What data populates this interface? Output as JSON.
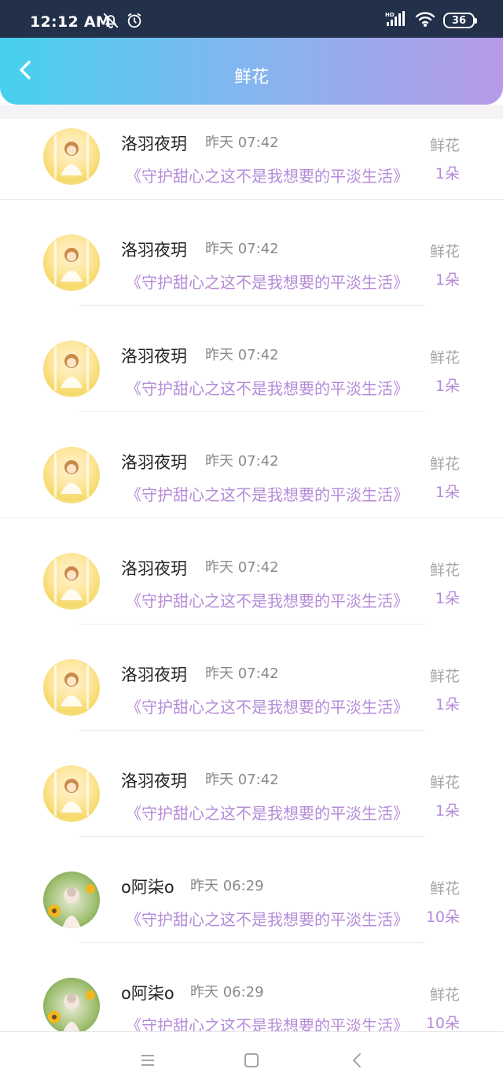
{
  "status_bar": {
    "time": "12:12 AM",
    "battery": "36",
    "icons": [
      "bell-off-icon",
      "alarm-icon",
      "hd-signal-icon",
      "wifi-icon",
      "battery-icon"
    ]
  },
  "header": {
    "title": "鲜花",
    "back_icon": "chevron-left-icon",
    "colors": {
      "gradient_start": "#45d1ee",
      "gradient_end": "#b79ae8"
    }
  },
  "list": {
    "items": [
      {
        "name": "洛羽夜玥",
        "time": "昨天 07:42",
        "desc": "《守护甜心之这不是我想要的平淡生活》",
        "type": "鲜花",
        "count": "1朵",
        "avatar": "flower-girl-avatar"
      },
      {
        "name": "洛羽夜玥",
        "time": "昨天 07:42",
        "desc": "《守护甜心之这不是我想要的平淡生活》",
        "type": "鲜花",
        "count": "1朵",
        "avatar": "flower-girl-avatar"
      },
      {
        "name": "洛羽夜玥",
        "time": "昨天 07:42",
        "desc": "《守护甜心之这不是我想要的平淡生活》",
        "type": "鲜花",
        "count": "1朵",
        "avatar": "flower-girl-avatar"
      },
      {
        "name": "洛羽夜玥",
        "time": "昨天 07:42",
        "desc": "《守护甜心之这不是我想要的平淡生活》",
        "type": "鲜花",
        "count": "1朵",
        "avatar": "flower-girl-avatar"
      },
      {
        "name": "洛羽夜玥",
        "time": "昨天 07:42",
        "desc": "《守护甜心之这不是我想要的平淡生活》",
        "type": "鲜花",
        "count": "1朵",
        "avatar": "flower-girl-avatar"
      },
      {
        "name": "洛羽夜玥",
        "time": "昨天 07:42",
        "desc": "《守护甜心之这不是我想要的平淡生活》",
        "type": "鲜花",
        "count": "1朵",
        "avatar": "flower-girl-avatar"
      },
      {
        "name": "洛羽夜玥",
        "time": "昨天 07:42",
        "desc": "《守护甜心之这不是我想要的平淡生活》",
        "type": "鲜花",
        "count": "1朵",
        "avatar": "flower-girl-avatar"
      },
      {
        "name": "o阿柒o",
        "time": "昨天 06:29",
        "desc": "《守护甜心之这不是我想要的平淡生活》",
        "type": "鲜花",
        "count": "10朵",
        "avatar": "sunflower-girl-avatar"
      },
      {
        "name": "o阿柒o",
        "time": "昨天 06:29",
        "desc": "《守护甜心之这不是我想要的平淡生活》",
        "type": "鲜花",
        "count": "10朵",
        "avatar": "sunflower-girl-avatar"
      }
    ]
  },
  "nav_bar": {
    "icons": [
      "menu-icon",
      "home-square-icon",
      "back-triangle-icon"
    ]
  },
  "colors": {
    "accent_purple": "#b58bd8",
    "muted_gray": "#a6a6a6"
  }
}
